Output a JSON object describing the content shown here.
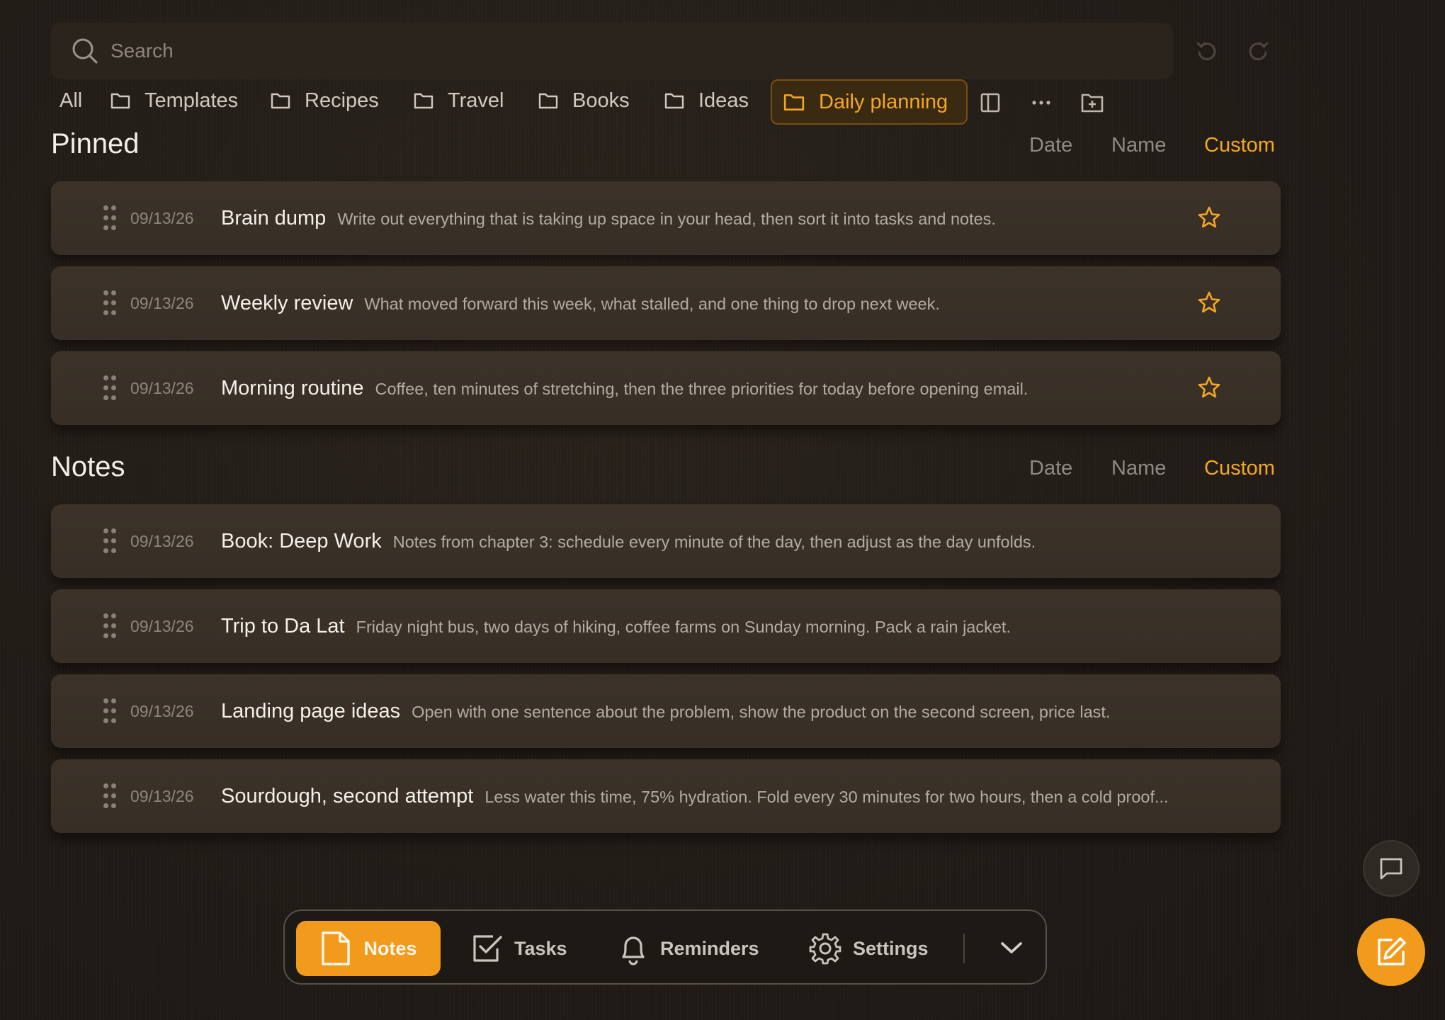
{
  "search": {
    "placeholder": "Search"
  },
  "folders": [
    {
      "label": "All"
    },
    {
      "label": "Templates"
    },
    {
      "label": "Recipes"
    },
    {
      "label": "Travel"
    },
    {
      "label": "Books"
    },
    {
      "label": "Ideas"
    },
    {
      "label": "Daily planning",
      "active": true
    }
  ],
  "sort_options": {
    "date": "Date",
    "name": "Name",
    "custom": "Custom",
    "selected": "Custom"
  },
  "pinned": {
    "title": "Pinned",
    "notes": [
      {
        "date": "09/13/26",
        "title": "Brain dump",
        "desc": "Write out everything that is taking up space in your head, then sort it into tasks and notes.",
        "starred": true
      },
      {
        "date": "09/13/26",
        "title": "Weekly review",
        "desc": "What moved forward this week, what stalled, and one thing to drop next week.",
        "starred": true
      },
      {
        "date": "09/13/26",
        "title": "Morning routine",
        "desc": "Coffee, ten minutes of stretching, then the three priorities for today before opening email.",
        "starred": true
      }
    ]
  },
  "notes": {
    "title": "Notes",
    "items": [
      {
        "date": "09/13/26",
        "title": "Book: Deep Work",
        "desc": "Notes from chapter 3: schedule every minute of the day, then adjust as the day unfolds."
      },
      {
        "date": "09/13/26",
        "title": "Trip to Da Lat",
        "desc": "Friday night bus, two days of hiking, coffee farms on Sunday morning. Pack a rain jacket."
      },
      {
        "date": "09/13/26",
        "title": "Landing page ideas",
        "desc": "Open with one sentence about the problem, show the product on the second screen, price last."
      },
      {
        "date": "09/13/26",
        "title": "Sourdough, second attempt",
        "desc": "Less water this time, 75% hydration. Fold every 30 minutes for two hours, then a cold proof..."
      }
    ]
  },
  "bottom_nav": {
    "items": [
      {
        "label": "Notes",
        "icon": "note-icon",
        "active": true
      },
      {
        "label": "Tasks",
        "icon": "checkbox-icon"
      },
      {
        "label": "Reminders",
        "icon": "bell-icon"
      },
      {
        "label": "Settings",
        "icon": "gear-icon"
      }
    ]
  },
  "colors": {
    "accent": "#f29a1b",
    "accent_text": "#f5a623",
    "background": "#201b16",
    "card": "#3a3027"
  }
}
